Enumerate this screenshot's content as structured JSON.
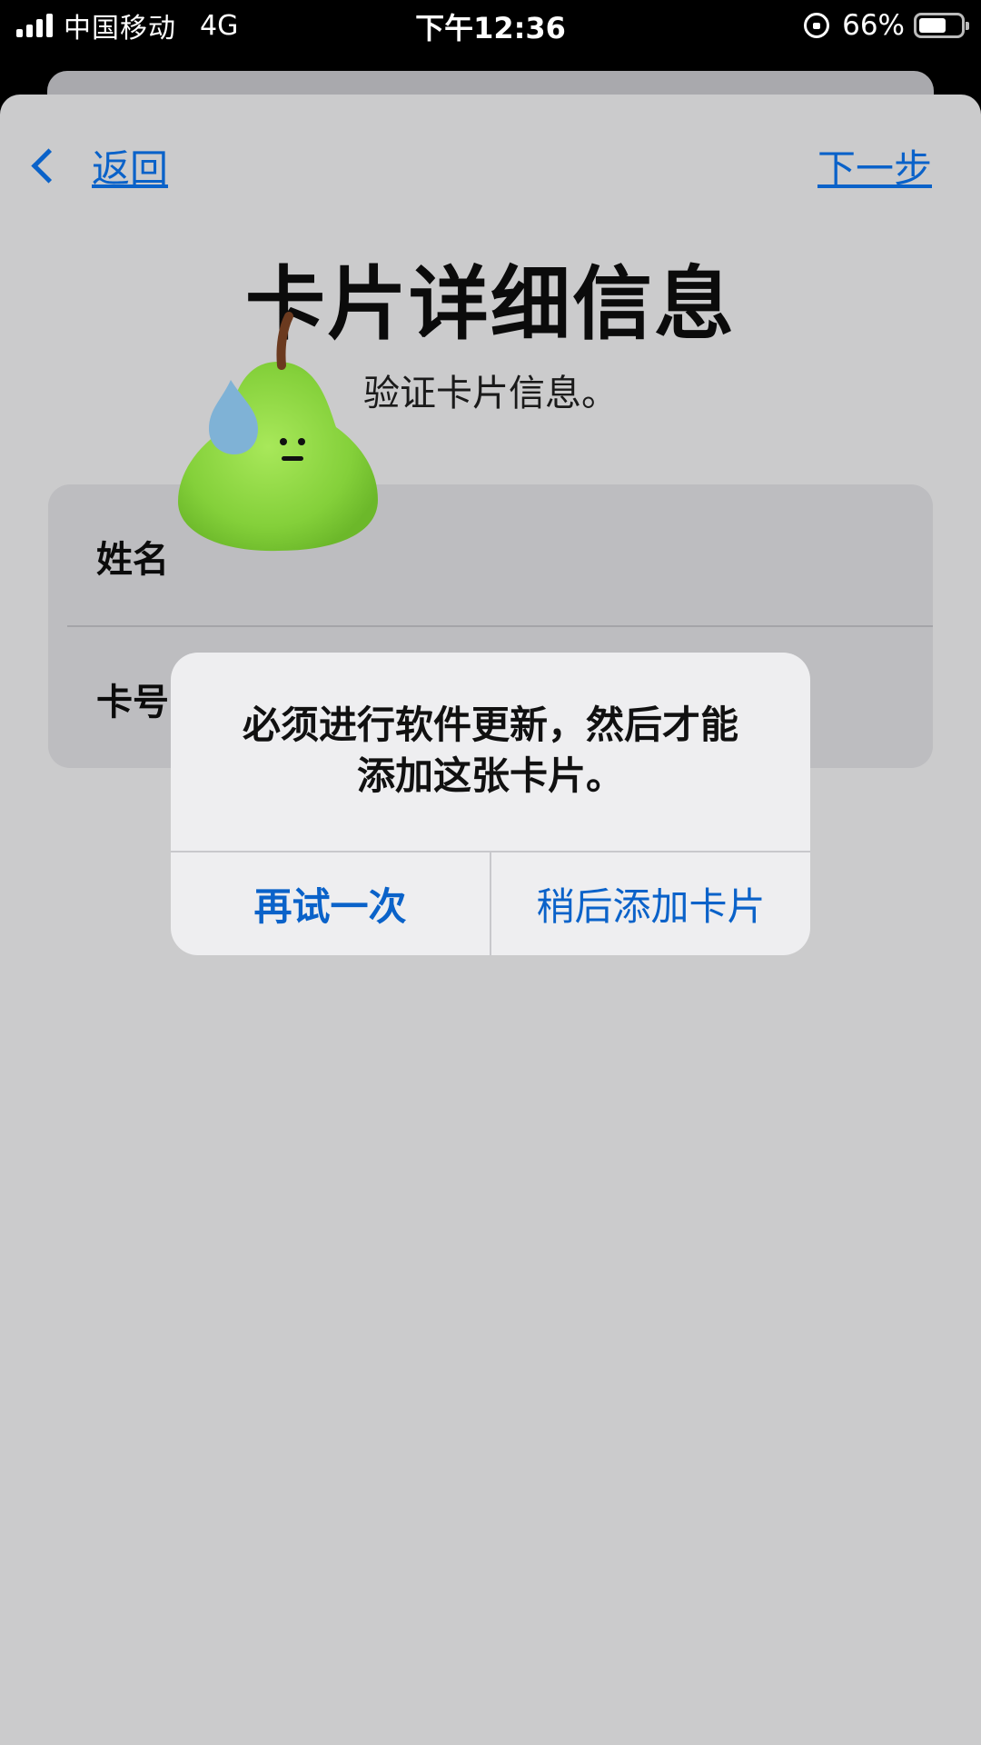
{
  "status_bar": {
    "carrier": "中国移动",
    "network": "4G",
    "time": "下午12:36",
    "battery_percent": "66%",
    "battery_level": 0.66,
    "signal_bars": 4
  },
  "nav": {
    "back_label": "返回",
    "next_label": "下一步"
  },
  "page": {
    "title": "卡片详细信息",
    "subtitle": "验证卡片信息。"
  },
  "form": {
    "fields": [
      {
        "label": "姓名"
      },
      {
        "label": "卡号"
      }
    ]
  },
  "alert": {
    "message_line1": "必须进行软件更新，然后才能",
    "message_line2": "添加这张卡片。",
    "buttons": [
      {
        "label": "再试一次"
      },
      {
        "label": "稍后添加卡片"
      }
    ]
  },
  "colors": {
    "accent": "#0a62c9",
    "sheet_bg": "#cbcbcc",
    "alert_bg": "#eeeef0",
    "pear_green": "#8ed63a",
    "sweat_drop": "#7fb2d6"
  },
  "icons": [
    "signal-icon",
    "rotation-lock-icon",
    "battery-icon",
    "chevron-left-icon",
    "pear-sticker"
  ]
}
